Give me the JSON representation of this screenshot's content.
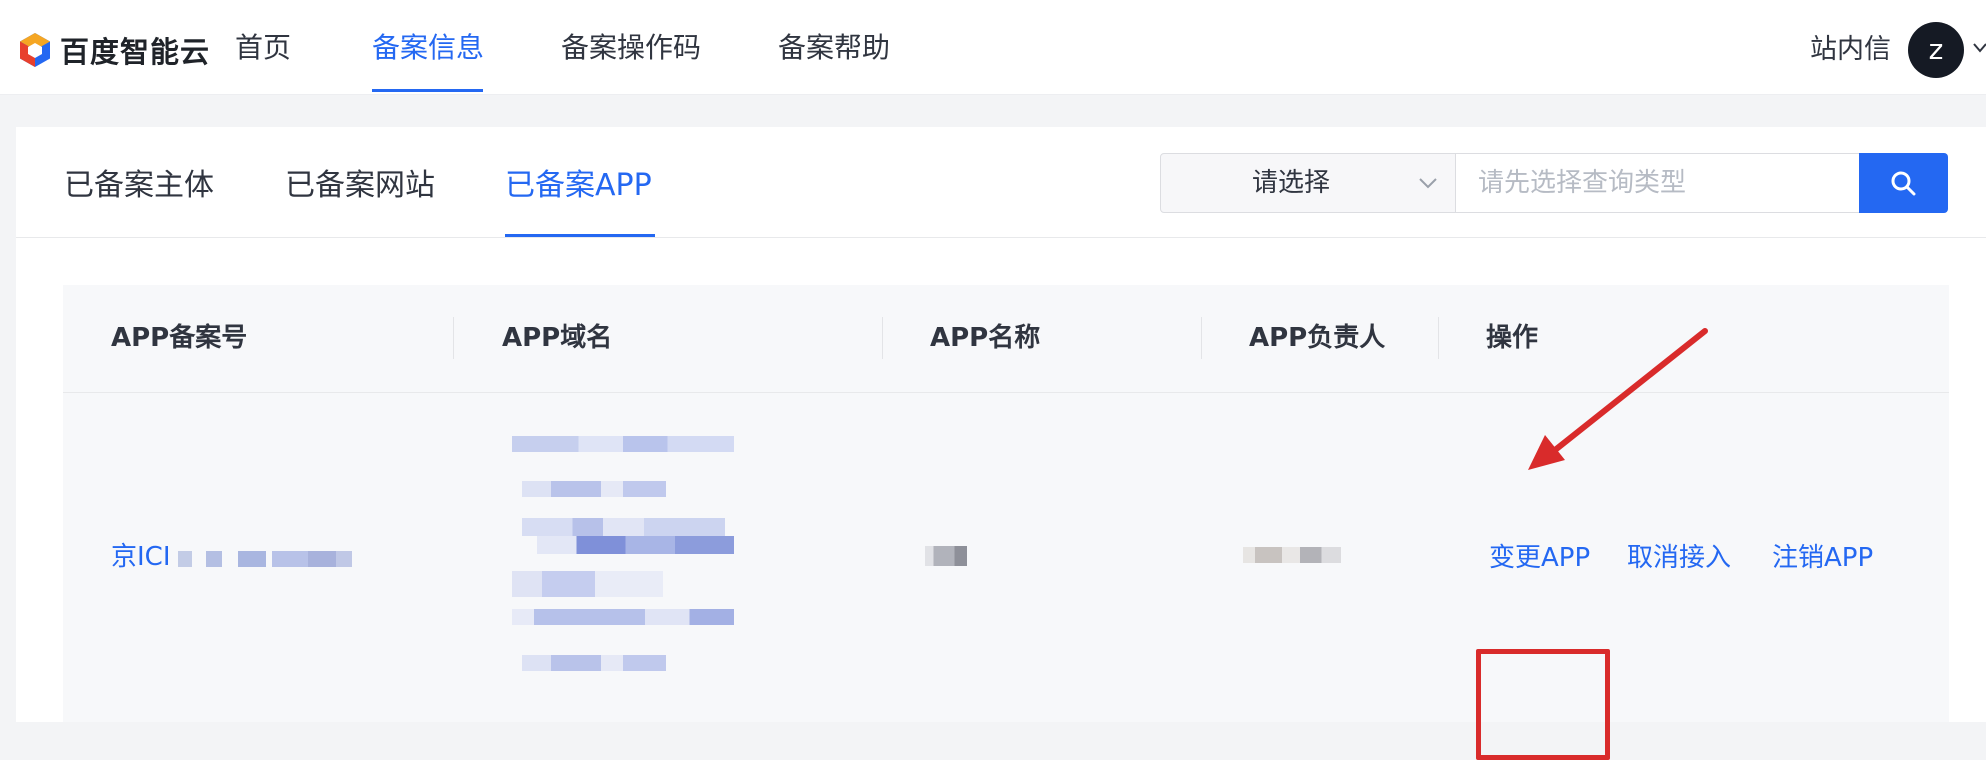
{
  "brand": {
    "name": "百度智能云",
    "logo_icon": "baidu-cloud-cube"
  },
  "nav": {
    "items": [
      "首页",
      "备案信息",
      "备案操作码",
      "备案帮助"
    ],
    "active_index": 1,
    "messages_label": "站内信",
    "avatar_letter": "z"
  },
  "tabs": {
    "items": [
      "已备案主体",
      "已备案网站",
      "已备案APP"
    ],
    "active_index": 2
  },
  "search": {
    "select_value": "请选择",
    "input_placeholder": "请先选择查询类型",
    "button_icon": "search-icon"
  },
  "table": {
    "columns": [
      "APP备案号",
      "APP域名",
      "APP名称",
      "APP负责人",
      "操作"
    ],
    "rows": [
      {
        "record_no_prefix": "京ICI",
        "actions": [
          "变更APP",
          "取消接入",
          "注销APP"
        ]
      }
    ]
  },
  "annotation": {
    "color": "#d92b2b",
    "highlighted_action": "变更APP"
  },
  "colors": {
    "accent": "#2468f2",
    "text": "#303540",
    "annotation": "#d92b2b"
  }
}
